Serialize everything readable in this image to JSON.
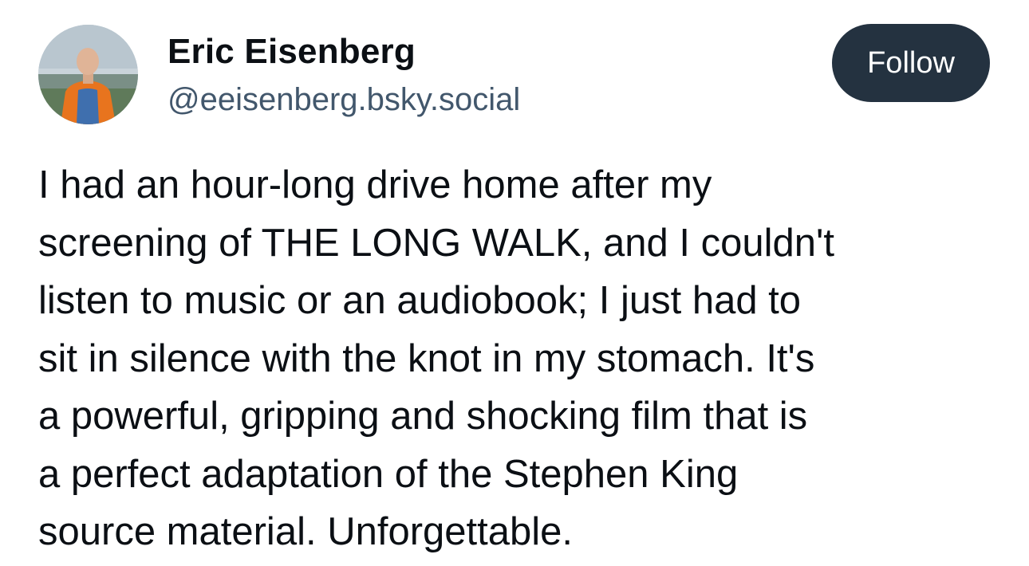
{
  "post": {
    "author": {
      "display_name": "Eric Eisenberg",
      "handle": "@eeisenberg.bsky.social",
      "avatar_icon": "user-photo-avatar"
    },
    "follow_label": "Follow",
    "text_lines": [
      "I had an hour-long drive home after my",
      "screening of THE LONG WALK, and I couldn't",
      "listen to music or an audiobook; I just had to",
      "sit in silence with the knot in my stomach. It's",
      "a powerful, gripping and shocking film that is",
      "a perfect adaptation of the Stephen King",
      "source material. Unforgettable."
    ]
  },
  "colors": {
    "text": "#0b0f14",
    "handle": "#42576c",
    "follow_button_bg": "#243240",
    "follow_button_text": "#ffffff",
    "background": "#ffffff"
  }
}
